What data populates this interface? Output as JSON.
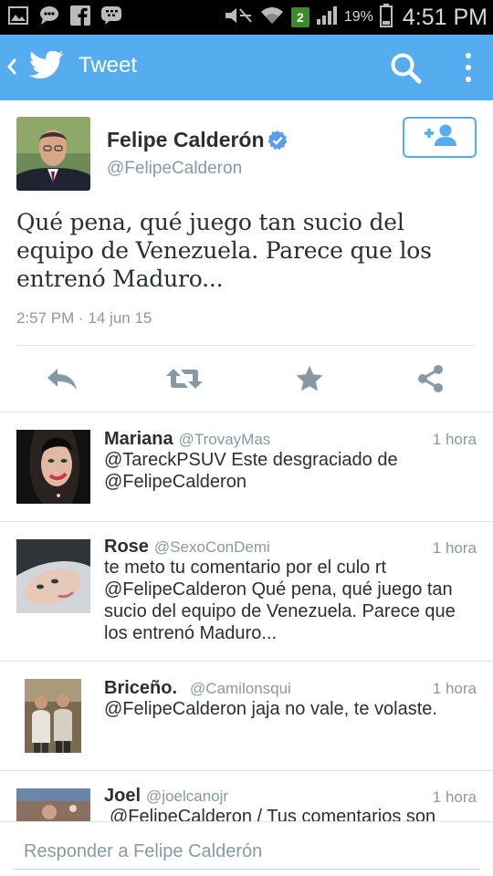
{
  "status_bar": {
    "left_icons": [
      "gallery-icon",
      "chat-icon",
      "facebook-icon",
      "bbm-icon"
    ],
    "sim_badge": "2",
    "battery_percent": "19%",
    "time": "4:51 PM"
  },
  "app_bar": {
    "title": "Tweet",
    "back_icon": "chevron-left-icon",
    "logo_icon": "twitter-bird-icon",
    "search_icon": "search-icon",
    "more_icon": "overflow-menu-icon",
    "color": "#55acee"
  },
  "tweet": {
    "author_name": "Felipe Calderón",
    "author_handle": "@FelipeCalderon",
    "verified": true,
    "text": "Qué pena, qué juego tan sucio del equipo de Venezuela. Parece que los entrenó Maduro...",
    "timestamp": "2:57 PM · 14 jun 15",
    "actions": [
      "reply-icon",
      "retweet-icon",
      "favorite-icon",
      "share-icon"
    ]
  },
  "replies": [
    {
      "name": "Mariana",
      "handle": "@TrovayMas",
      "time": "1 hora",
      "text": "@TareckPSUV Este desgraciado de @FelipeCalderon"
    },
    {
      "name": "Rose",
      "handle": "@SexoConDemi",
      "time": "1 hora",
      "text": "te meto tu comentario por el culo rt @FelipeCalderon Qué pena, qué juego tan sucio del equipo de Venezuela. Parece que los entrenó Maduro..."
    },
    {
      "name": "Briceño.",
      "handle": "@Camilonsqui",
      "time": "1 hora",
      "text": "@FelipeCalderon jaja no vale, te volaste."
    },
    {
      "name": "Joel",
      "handle": "@joelcanojr",
      "time": "1 hora",
      "text": "@FelipeCalderon / Tus comentarios son"
    }
  ],
  "compose": {
    "placeholder": "Responder a Felipe Calderón"
  },
  "colors": {
    "accent": "#55acee",
    "text": "#292f33",
    "secondary": "#8899a6",
    "divider": "#e1e8ed"
  }
}
